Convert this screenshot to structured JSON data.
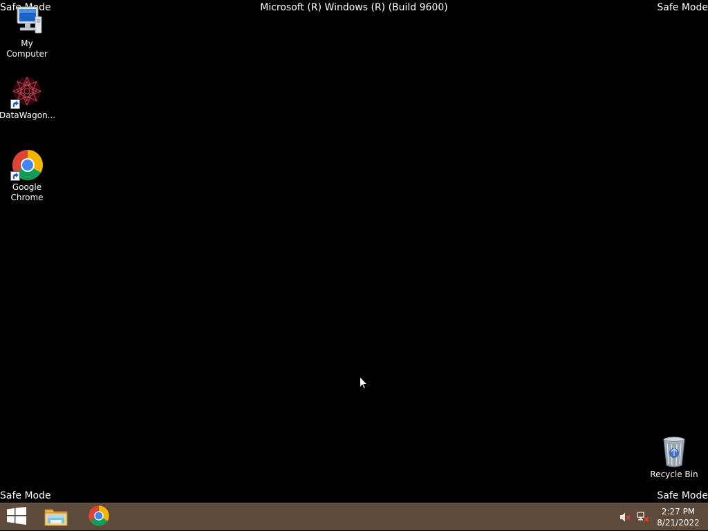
{
  "overlay": {
    "safe_mode": "Safe Mode",
    "build": "Microsoft (R) Windows (R) (Build 9600)"
  },
  "desktop_icons": [
    {
      "label": "My Computer",
      "icon": "computer-icon"
    },
    {
      "label": "DataWagon...",
      "icon": "datawagon-icon"
    },
    {
      "label": "Google Chrome",
      "icon": "chrome-icon"
    },
    {
      "label": "Recycle Bin",
      "icon": "recycle-bin-icon"
    }
  ],
  "taskbar": {
    "start_icon": "windows-logo-icon",
    "pinned": [
      {
        "name": "File Explorer",
        "icon": "file-explorer-icon"
      },
      {
        "name": "Google Chrome",
        "icon": "chrome-icon"
      }
    ],
    "tray": {
      "volume_icon": "volume-muted-icon",
      "network_icon": "network-disconnected-icon"
    },
    "clock": {
      "time": "2:27 PM",
      "date": "8/21/2022"
    }
  },
  "colors": {
    "desktop_background": "#000000",
    "taskbar": "#5e4a3b",
    "text": "#ffffff"
  }
}
